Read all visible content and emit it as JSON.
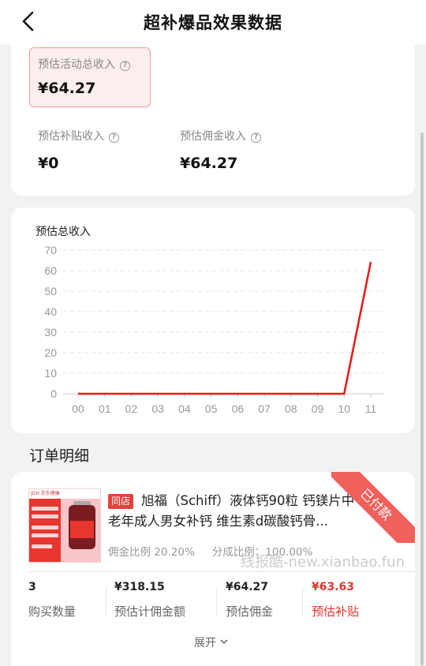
{
  "header": {
    "title": "超补爆品效果数据",
    "back_icon": "chevron-left-icon"
  },
  "summary": {
    "total_label": "预估活动总收入",
    "total_value": "¥64.27",
    "subsidy_label": "预估补贴收入",
    "subsidy_value": "¥0",
    "commission_label": "预估佣金收入",
    "commission_value": "¥64.27"
  },
  "chart_data": {
    "type": "line",
    "title": "预估总收入",
    "categories": [
      "00",
      "01",
      "02",
      "03",
      "04",
      "05",
      "06",
      "07",
      "08",
      "09",
      "10",
      "11"
    ],
    "values": [
      0,
      0,
      0,
      0,
      0,
      0,
      0,
      0,
      0,
      0,
      0,
      64.27
    ],
    "ylim": [
      0,
      70
    ],
    "yticks": [
      0,
      10,
      20,
      30,
      40,
      50,
      60,
      70
    ],
    "grid": true,
    "line_color": "#e31e1e"
  },
  "orders": {
    "section_title": "订单明细",
    "item": {
      "store_tag": "同店",
      "title": "旭福（Schiff）液体钙90粒 钙镁片中老年成人男女补钙 维生素d碳酸钙骨...",
      "commission_ratio": "佣金比例 20.20%",
      "share_ratio": "分成比例：100.00%",
      "status_ribbon": "已付款",
      "image_text": "美国专业膳食营养补剂品牌 800mg高含量液体钙",
      "stats": [
        {
          "value": "3",
          "label": "购买数量"
        },
        {
          "value": "¥318.15",
          "label": "预估计佣金额"
        },
        {
          "value": "¥64.27",
          "label": "预估佣金"
        },
        {
          "value": "¥63.63",
          "label": "预估补贴"
        }
      ],
      "expand_label": "展开"
    }
  },
  "watermark": "线报酷-new.xianbao.fun",
  "colors": {
    "accent": "#e8352f",
    "background": "#f2f2f4",
    "highlight_bg": "#fdeeee"
  }
}
